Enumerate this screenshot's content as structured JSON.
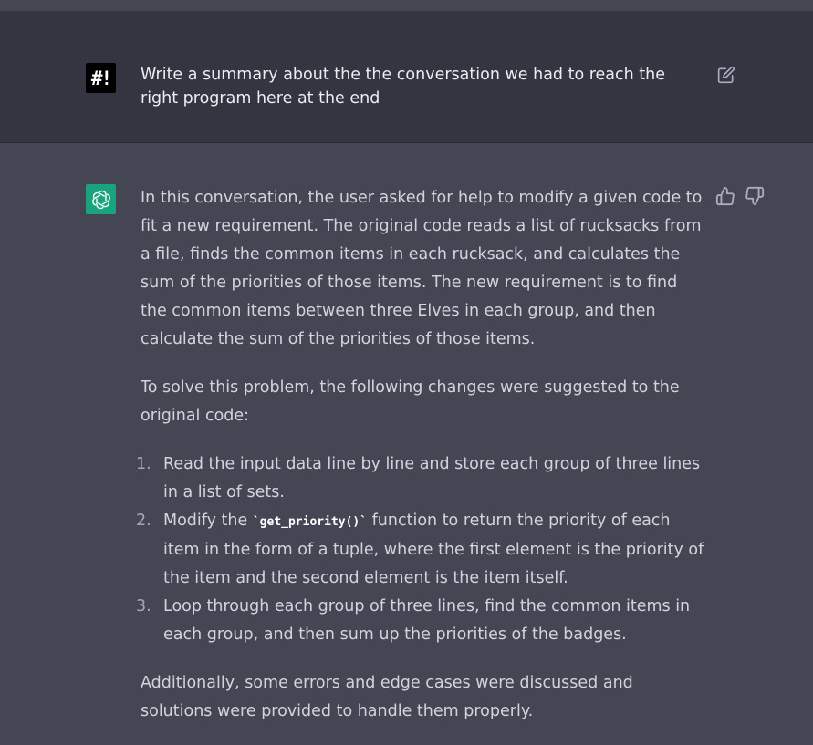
{
  "user_message": {
    "avatar_text": "#!",
    "text": "Write a summary about the the conversation we had to reach the right program here at the end"
  },
  "assistant_message": {
    "intro": "In this conversation, the user asked for help to modify a given code to fit a new requirement. The original code reads a list of rucksacks from a file, finds the common items in each rucksack, and calculates the sum of the priorities of those items. The new requirement is to find the common items between three Elves in each group, and then calculate the sum of the priorities of those items.",
    "lead_in": "To solve this problem, the following changes were suggested to the original code:",
    "steps": [
      {
        "num": "1.",
        "text": "Read the input data line by line and store each group of three lines in a list of sets."
      },
      {
        "num": "2.",
        "before": "Modify the ",
        "code": "`get_priority()`",
        "after": " function to return the priority of each item in the form of a tuple, where the first element is the priority of the item and the second element is the item itself."
      },
      {
        "num": "3.",
        "text": "Loop through each group of three lines, find the common items in each group, and then sum up the priorities of the badges."
      }
    ],
    "closing": "Additionally, some errors and edge cases were discussed and solutions were provided to handle them properly."
  },
  "icons": {
    "user_avatar": "hashbang-avatar-icon",
    "edit": "edit-icon",
    "assistant_avatar": "openai-logo-icon",
    "thumbs_up": "thumbs-up-icon",
    "thumbs_down": "thumbs-down-icon"
  },
  "colors": {
    "user_bg": "#343541",
    "assistant_bg": "#444654",
    "gpt_avatar": "#19a37f"
  }
}
